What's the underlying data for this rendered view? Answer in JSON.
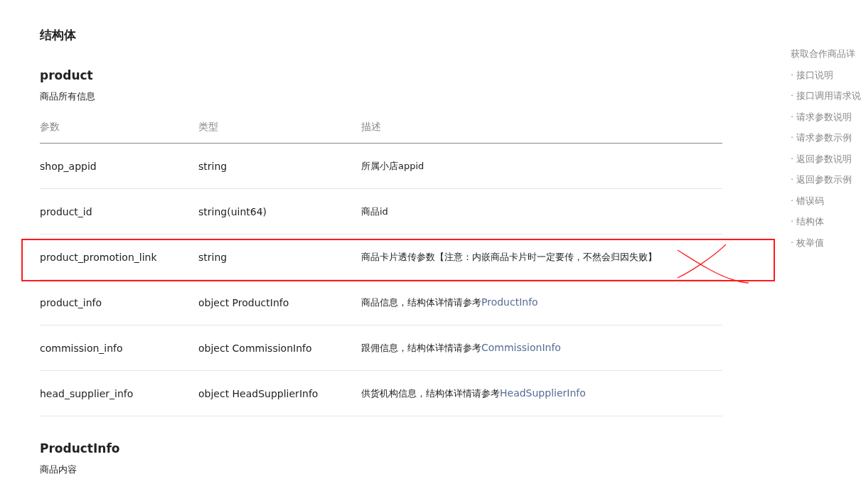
{
  "page_title": "结构体",
  "sections": [
    {
      "name": "product",
      "description": "商品所有信息",
      "columns": [
        "参数",
        "类型",
        "描述"
      ],
      "rows": [
        {
          "param": "shop_appid",
          "type": "string",
          "desc": "所属小店appid",
          "annotated": false
        },
        {
          "param": "product_id",
          "type": "string(uint64)",
          "desc": "商品id",
          "annotated": false
        },
        {
          "param": "product_promotion_link",
          "type": "string",
          "desc": "商品卡片透传参数【注意：内嵌商品卡片时一定要传，不然会归因失败】",
          "annotated": true
        },
        {
          "param": "product_info",
          "type": "object ProductInfo",
          "desc": "商品信息，结构体详情请参考",
          "link": "ProductInfo",
          "annotated": false
        },
        {
          "param": "commission_info",
          "type": "object CommissionInfo",
          "desc": "跟佣信息，结构体详情请参考",
          "link": "CommissionInfo",
          "annotated": false
        },
        {
          "param": "head_supplier_info",
          "type": "object HeadSupplierInfo",
          "desc": "供货机构信息，结构体详情请参考",
          "link": "HeadSupplierInfo",
          "annotated": false
        }
      ]
    },
    {
      "name": "ProductInfo",
      "description": "商品内容"
    }
  ],
  "toc": {
    "title": "获取合作商品详",
    "items": [
      "· 接口说明",
      "· 接口调用请求说",
      "· 请求参数说明",
      "· 请求参数示例",
      "· 返回参数说明",
      "· 返回参数示例",
      "· 错误码",
      "· 结构体",
      "· 枚举值"
    ]
  }
}
